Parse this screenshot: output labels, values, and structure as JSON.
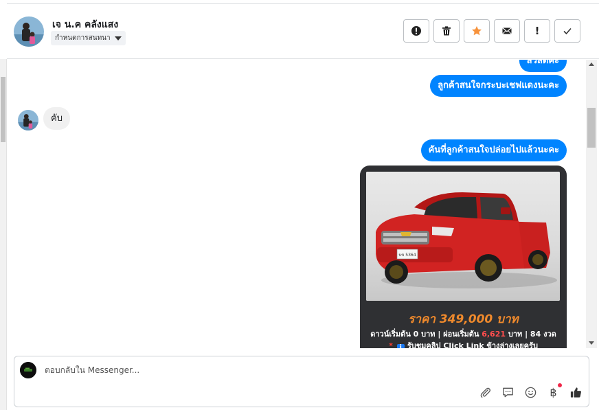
{
  "header": {
    "contact_name": "เจ น.ค คลังแสง",
    "label_button": "กำหนดการสนทนา",
    "actions": [
      {
        "name": "report-spam",
        "icon": "alert-circle-icon"
      },
      {
        "name": "delete",
        "icon": "trash-icon"
      },
      {
        "name": "star",
        "icon": "star-icon",
        "glyph_color": "#f7923b"
      },
      {
        "name": "mark-unread",
        "icon": "envelope-icon"
      },
      {
        "name": "follow-up",
        "icon": "exclamation-icon",
        "glyph": "!"
      },
      {
        "name": "mark-done",
        "icon": "checkmark-icon"
      }
    ]
  },
  "messages": [
    {
      "direction": "out",
      "text": "สวัสดีคะ"
    },
    {
      "direction": "out",
      "text": "ลูกค้าสนใจกระบะเชฟแดงนะคะ"
    },
    {
      "direction": "in",
      "text": "คับ"
    },
    {
      "direction": "out",
      "text": "คันที่ลูกค้าสนใจปล่อยไปแล้วนะคะ"
    }
  ],
  "card": {
    "plate": "บข 5364",
    "price": "ราคา 349,000 บาท",
    "terms_prefix": "ดาวน์เริ่มต้น 0 บาท | ผ่อนเริ่มต้น ",
    "terms_highlight": "6,621",
    "terms_suffix": " บาท | 84 งวด",
    "clip_star": "*",
    "clip_info": "i",
    "clip_text": "รับชมคลิป Click Link ข้างล่างเลยครับ"
  },
  "composer": {
    "placeholder": "ตอบกลับใน Messenger...",
    "tools": [
      "paperclip-icon",
      "saved-replies-icon",
      "emoji-icon",
      "baht-payment-icon",
      "thumbs-up-icon"
    ],
    "baht_glyph": "฿"
  },
  "colors": {
    "accent": "#0084ff",
    "star": "#f7923b",
    "price": "#f08a2c",
    "notification": "#f02849"
  }
}
